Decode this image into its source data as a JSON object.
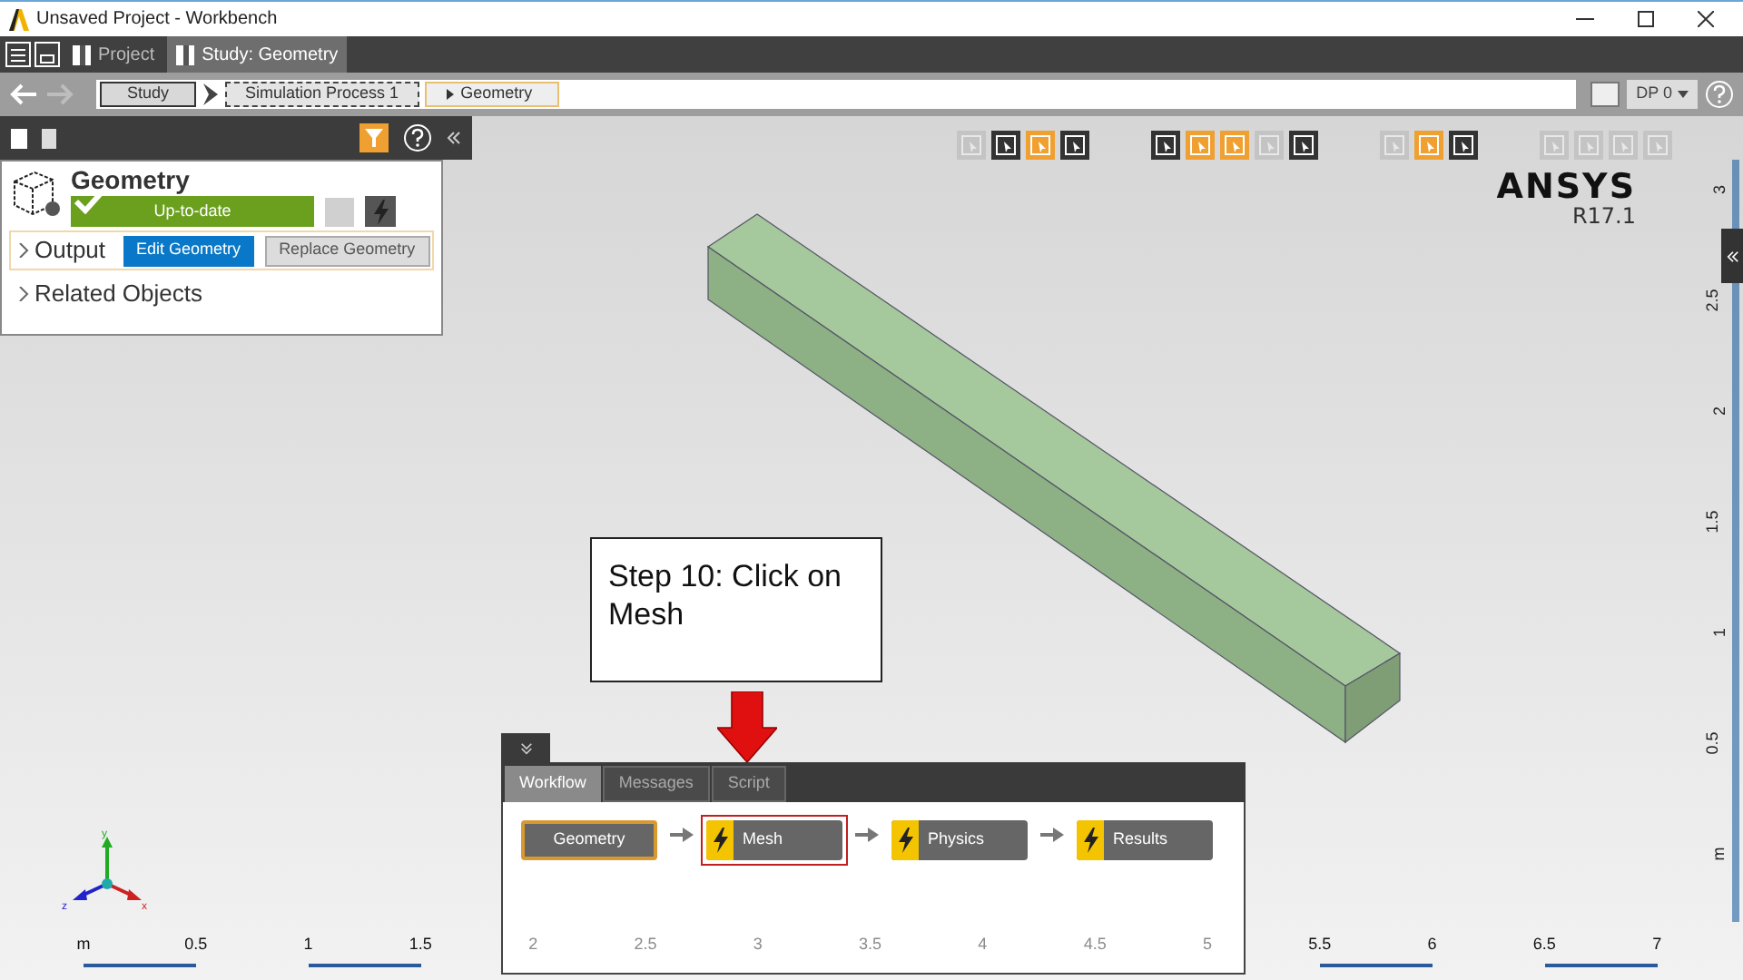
{
  "window": {
    "title": "Unsaved Project - Workbench"
  },
  "tabs": [
    {
      "label": "Project",
      "selected": false
    },
    {
      "label": "Study: Geometry",
      "selected": true
    }
  ],
  "breadcrumb": [
    {
      "label": "Study",
      "kind": "plain"
    },
    {
      "label": "Simulation Process 1",
      "kind": "dashed"
    },
    {
      "label": "Geometry",
      "kind": "current"
    }
  ],
  "design_point": "DP 0",
  "view_toolbar": [
    [
      {
        "on": false,
        "disabled": true
      },
      {
        "on": false,
        "disabled": false
      },
      {
        "on": true,
        "disabled": false
      },
      {
        "on": false,
        "disabled": false
      }
    ],
    [
      {
        "on": false,
        "disabled": false
      },
      {
        "on": true,
        "disabled": false
      },
      {
        "on": true,
        "disabled": false
      },
      {
        "on": false,
        "disabled": true
      },
      {
        "on": false,
        "disabled": false
      }
    ],
    [
      {
        "on": false,
        "disabled": true
      },
      {
        "on": true,
        "disabled": false
      },
      {
        "on": false,
        "disabled": false
      }
    ],
    [
      {
        "on": false,
        "disabled": true
      },
      {
        "on": false,
        "disabled": true
      },
      {
        "on": false,
        "disabled": true
      },
      {
        "on": false,
        "disabled": true
      }
    ]
  ],
  "object_panel": {
    "title": "Geometry",
    "status": "Up-to-date",
    "up_to_date": true,
    "sections": [
      {
        "label": "Output",
        "expanded": false,
        "highlighted": true,
        "buttons": [
          {
            "label": "Edit Geometry",
            "primary": true
          },
          {
            "label": "Replace Geometry",
            "primary": false
          }
        ]
      },
      {
        "label": "Related Objects",
        "expanded": false,
        "highlighted": false
      }
    ]
  },
  "brand": {
    "name": "ANSYS",
    "version": "R17.1"
  },
  "axis_y_labels": [
    "3",
    "2.5",
    "2",
    "1.5",
    "1",
    "0.5",
    "m"
  ],
  "axis_x_labels": [
    {
      "label": "m",
      "dimmed": false
    },
    {
      "label": "0.5",
      "dimmed": false
    },
    {
      "label": "1",
      "dimmed": false
    },
    {
      "label": "1.5",
      "dimmed": false
    },
    {
      "label": "2",
      "dimmed": true
    },
    {
      "label": "2.5",
      "dimmed": true
    },
    {
      "label": "3",
      "dimmed": true
    },
    {
      "label": "3.5",
      "dimmed": true
    },
    {
      "label": "4",
      "dimmed": true
    },
    {
      "label": "4.5",
      "dimmed": true
    },
    {
      "label": "5",
      "dimmed": true
    },
    {
      "label": "5.5",
      "dimmed": false
    },
    {
      "label": "6",
      "dimmed": false
    },
    {
      "label": "6.5",
      "dimmed": false
    },
    {
      "label": "7",
      "dimmed": false
    }
  ],
  "triad": {
    "x": "x",
    "y": "y",
    "z": "z"
  },
  "callout": {
    "text": "Step 10: Click on Mesh"
  },
  "workflow_panel": {
    "tabs": [
      {
        "label": "Workflow",
        "selected": true
      },
      {
        "label": "Messages",
        "selected": false
      },
      {
        "label": "Script",
        "selected": false
      }
    ],
    "steps": [
      {
        "label": "Geometry",
        "kind": "done",
        "highlighted": false
      },
      {
        "label": "Mesh",
        "kind": "pending",
        "highlighted": true
      },
      {
        "label": "Physics",
        "kind": "pending",
        "highlighted": false
      },
      {
        "label": "Results",
        "kind": "pending",
        "highlighted": false
      }
    ]
  }
}
